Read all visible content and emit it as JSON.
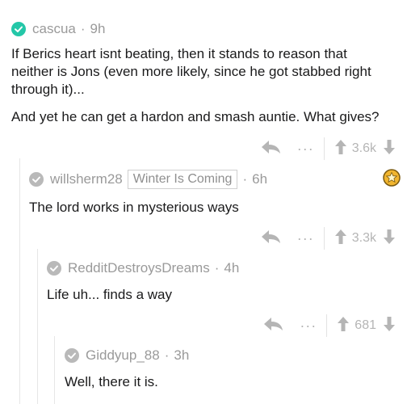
{
  "comments": [
    {
      "user": "cascua",
      "time": "9h",
      "paragraphs": [
        "If Berics heart isnt beating, then it stands to reason that neither is Jons (even more likely, since he got stabbed right through it)...",
        "And yet he can get a hardon and smash auntie. What gives?"
      ],
      "score": "3.6k",
      "check_color": "#24c7a8"
    },
    {
      "user": "willsherm28",
      "flair": "Winter Is Coming",
      "time": "6h",
      "paragraphs": [
        "The lord works in mysterious ways"
      ],
      "score": "3.3k",
      "check_color": "#b9b9b9"
    },
    {
      "user": "RedditDestroysDreams",
      "time": "4h",
      "paragraphs": [
        "Life uh... finds a way"
      ],
      "score": "681",
      "check_color": "#b9b9b9"
    },
    {
      "user": "Giddyup_88",
      "time": "3h",
      "paragraphs": [
        "Well, there it is."
      ],
      "check_color": "#b9b9b9"
    }
  ],
  "icons": {
    "reply": "reply-arrow-icon",
    "more": "more-dots-icon",
    "upvote": "upvote-arrow-icon",
    "downvote": "downvote-arrow-icon",
    "award": "gold-award-icon"
  },
  "dot": "·",
  "more_glyph": "···"
}
